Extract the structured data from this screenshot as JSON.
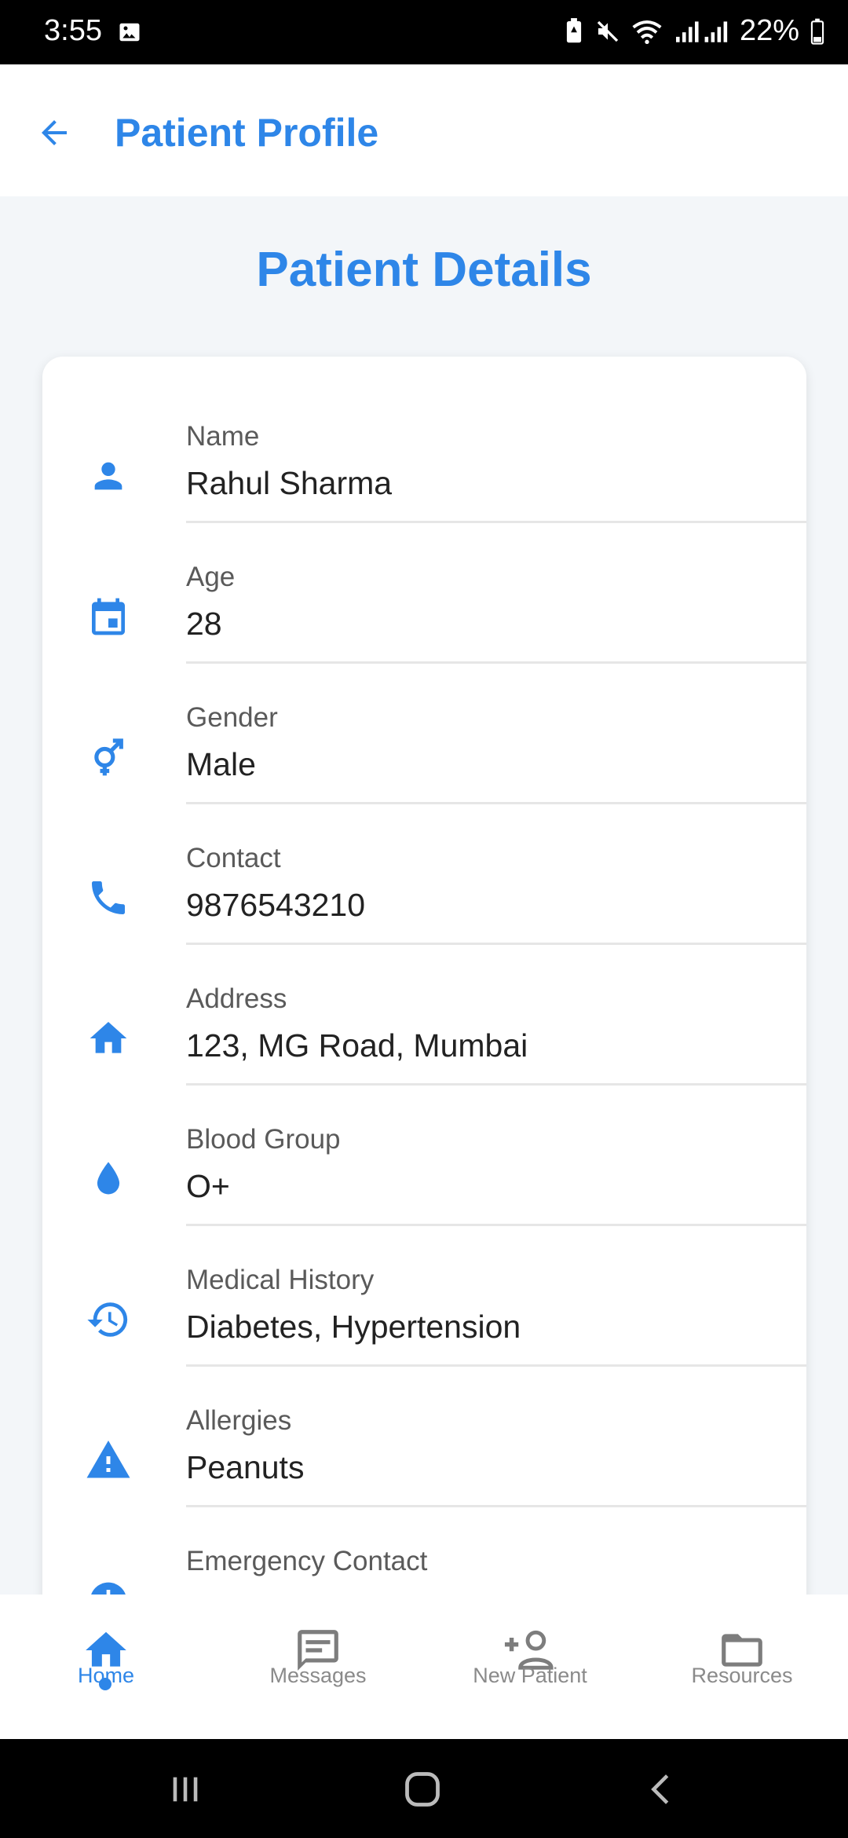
{
  "status_bar": {
    "time": "3:55",
    "battery": "22%"
  },
  "app_bar": {
    "title": "Patient Profile"
  },
  "page": {
    "heading": "Patient Details"
  },
  "details": [
    {
      "label": "Name",
      "value": "Rahul Sharma",
      "icon": "person-icon"
    },
    {
      "label": "Age",
      "value": "28",
      "icon": "calendar-icon"
    },
    {
      "label": "Gender",
      "value": "Male",
      "icon": "gender-icon"
    },
    {
      "label": "Contact",
      "value": "9876543210",
      "icon": "phone-icon"
    },
    {
      "label": "Address",
      "value": "123, MG Road, Mumbai",
      "icon": "home-icon"
    },
    {
      "label": "Blood Group",
      "value": "O+",
      "icon": "water-drop-icon"
    },
    {
      "label": "Medical History",
      "value": "Diabetes, Hypertension",
      "icon": "history-icon"
    },
    {
      "label": "Allergies",
      "value": "Peanuts",
      "icon": "warning-icon"
    },
    {
      "label": "Emergency Contact",
      "value": "",
      "icon": "info-icon"
    }
  ],
  "bottom_nav": {
    "items": [
      {
        "label": "Home",
        "icon": "home-icon",
        "active": true
      },
      {
        "label": "Messages",
        "icon": "message-icon",
        "active": false
      },
      {
        "label": "New Patient",
        "icon": "add-person-icon",
        "active": false
      },
      {
        "label": "Resources",
        "icon": "folder-icon",
        "active": false
      }
    ]
  },
  "colors": {
    "accent": "#2e86e8",
    "background": "#f3f6f9",
    "inactive": "#8a8a8a"
  }
}
